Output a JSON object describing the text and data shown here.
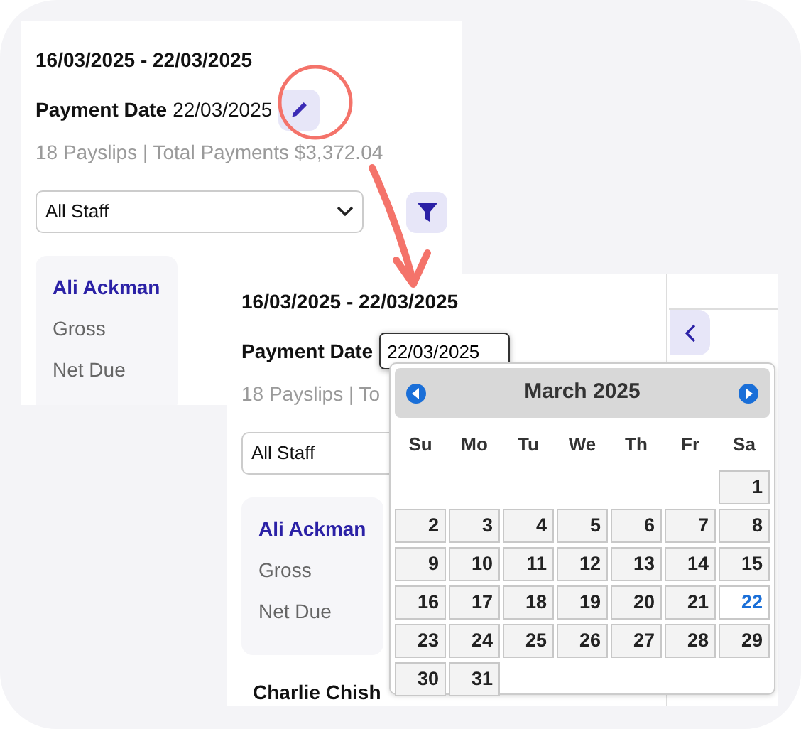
{
  "panels": [
    {
      "kind": "view",
      "date_range": "16/03/2025 - 22/03/2025",
      "payment_label": "Payment Date",
      "payment_date": "22/03/2025",
      "summary": "18 Payslips | Total Payments $3,372.04",
      "staff_filter": "All Staff",
      "staff": [
        {
          "name": "Ali Ackman",
          "lines": [
            "Gross",
            "Net Due"
          ]
        }
      ]
    },
    {
      "kind": "edit",
      "date_range": "16/03/2025 - 22/03/2025",
      "payment_label": "Payment Date",
      "payment_date": "22/03/2025",
      "summary": "18 Payslips | To",
      "staff_filter": "All Staff",
      "staff": [
        {
          "name": "Ali Ackman",
          "lines": [
            "Gross",
            "Net Due"
          ]
        }
      ],
      "next_name": "Charlie Chish"
    }
  ],
  "calendar": {
    "title": "March 2025",
    "weekdays": [
      "Su",
      "Mo",
      "Tu",
      "We",
      "Th",
      "Fr",
      "Sa"
    ],
    "weeks": [
      [
        {
          "kind": "empty"
        },
        {
          "kind": "empty"
        },
        {
          "kind": "empty"
        },
        {
          "kind": "empty"
        },
        {
          "kind": "empty"
        },
        {
          "kind": "empty"
        },
        {
          "kind": "day",
          "label": "1",
          "selected": false
        }
      ],
      [
        {
          "kind": "day",
          "label": "2",
          "selected": false
        },
        {
          "kind": "day",
          "label": "3",
          "selected": false
        },
        {
          "kind": "day",
          "label": "4",
          "selected": false
        },
        {
          "kind": "day",
          "label": "5",
          "selected": false
        },
        {
          "kind": "day",
          "label": "6",
          "selected": false
        },
        {
          "kind": "day",
          "label": "7",
          "selected": false
        },
        {
          "kind": "day",
          "label": "8",
          "selected": false
        }
      ],
      [
        {
          "kind": "day",
          "label": "9",
          "selected": false
        },
        {
          "kind": "day",
          "label": "10",
          "selected": false
        },
        {
          "kind": "day",
          "label": "11",
          "selected": false
        },
        {
          "kind": "day",
          "label": "12",
          "selected": false
        },
        {
          "kind": "day",
          "label": "13",
          "selected": false
        },
        {
          "kind": "day",
          "label": "14",
          "selected": false
        },
        {
          "kind": "day",
          "label": "15",
          "selected": false
        }
      ],
      [
        {
          "kind": "day",
          "label": "16",
          "selected": false
        },
        {
          "kind": "day",
          "label": "17",
          "selected": false
        },
        {
          "kind": "day",
          "label": "18",
          "selected": false
        },
        {
          "kind": "day",
          "label": "19",
          "selected": false
        },
        {
          "kind": "day",
          "label": "20",
          "selected": false
        },
        {
          "kind": "day",
          "label": "21",
          "selected": false
        },
        {
          "kind": "day",
          "label": "22",
          "selected": true
        }
      ],
      [
        {
          "kind": "day",
          "label": "23",
          "selected": false
        },
        {
          "kind": "day",
          "label": "24",
          "selected": false
        },
        {
          "kind": "day",
          "label": "25",
          "selected": false
        },
        {
          "kind": "day",
          "label": "26",
          "selected": false
        },
        {
          "kind": "day",
          "label": "27",
          "selected": false
        },
        {
          "kind": "day",
          "label": "28",
          "selected": false
        },
        {
          "kind": "day",
          "label": "29",
          "selected": false
        }
      ],
      [
        {
          "kind": "day",
          "label": "30",
          "selected": false
        },
        {
          "kind": "day",
          "label": "31",
          "selected": false
        }
      ]
    ]
  }
}
